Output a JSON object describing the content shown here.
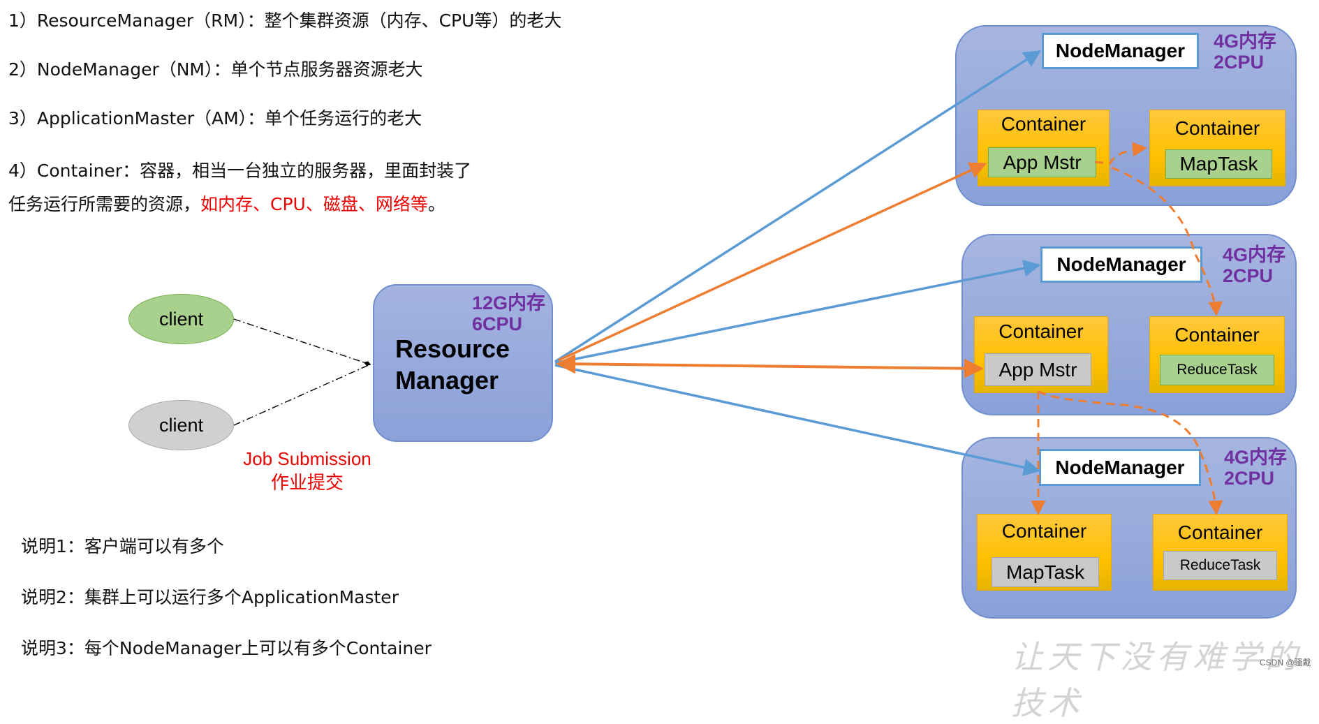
{
  "notes": {
    "line1": "1）ResourceManager（RM）：整个集群资源（内存、CPU等）的老大",
    "line2": "2）NodeManager（NM）：单个节点服务器资源老大",
    "line3": "3）ApplicationMaster（AM）：单个任务运行的老大",
    "line4": "4）Container：容器，相当一台独立的服务器，里面封装了",
    "line5_black": "任务运行所需要的资源，",
    "line5_red": "如内存、CPU、磁盘、网络等",
    "line5_end": "。"
  },
  "explanations": [
    "说明1：客户端可以有多个",
    "说明2：集群上可以运行多个ApplicationMaster",
    "说明3：每个NodeManager上可以有多个Container"
  ],
  "clients": [
    {
      "label": "client",
      "color": "#a9d18e"
    },
    {
      "label": "client",
      "color": "#d0d0d0"
    }
  ],
  "job_submission": {
    "en": "Job Submission",
    "zh": "作业提交"
  },
  "resource_manager": {
    "line1": "Resource",
    "line2": "Manager",
    "mem": "12G内存",
    "cpu": "6CPU"
  },
  "node_managers": [
    {
      "label": "NodeManager",
      "mem": "4G内存",
      "cpu": "2CPU",
      "containers": [
        {
          "title": "Container",
          "task": "App Mstr",
          "task_style": "green"
        },
        {
          "title": "Container",
          "task": "MapTask",
          "task_style": "green"
        }
      ]
    },
    {
      "label": "NodeManager",
      "mem": "4G内存",
      "cpu": "2CPU",
      "containers": [
        {
          "title": "Container",
          "task": "App Mstr",
          "task_style": "gray"
        },
        {
          "title": "Container",
          "task": "ReduceTask",
          "task_style": "green"
        }
      ]
    },
    {
      "label": "NodeManager",
      "mem": "4G内存",
      "cpu": "2CPU",
      "containers": [
        {
          "title": "Container",
          "task": "MapTask",
          "task_style": "gray"
        },
        {
          "title": "Container",
          "task": "ReduceTask",
          "task_style": "gray"
        }
      ]
    }
  ],
  "colors": {
    "blue_arrow": "#5b9bd5",
    "orange_arrow": "#ed7d31",
    "purple_text": "#7030a0",
    "container_yellow": "#ffc000",
    "red_text": "#ee0000"
  },
  "watermark": "让天下没有难学的技术",
  "credit": "CSDN @骚戴"
}
